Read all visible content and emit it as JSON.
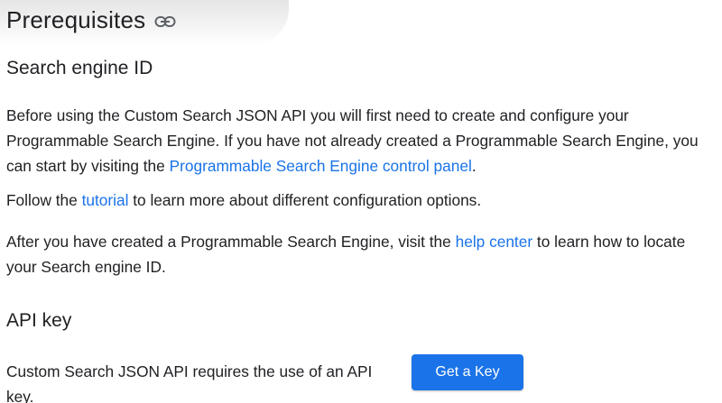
{
  "heading": "Prerequisites",
  "icons": {
    "heading_link": "link-icon"
  },
  "colors": {
    "link": "#1a73e8",
    "button_bg": "#1a73e8",
    "text": "#202124"
  },
  "search_engine": {
    "title": "Search engine ID",
    "para1_a": "Before using the Custom Search JSON API you will first need to create and configure your Programmable Search Engine. If you have not already created a Programmable Search Engine, you can start by visiting the ",
    "para1_link": "Programmable Search Engine control panel",
    "para1_b": ".",
    "para2_a": "Follow the ",
    "para2_link": "tutorial",
    "para2_b": " to learn more about different configuration options.",
    "para3_a": "After you have created a Programmable Search Engine, visit the ",
    "para3_link": "help center",
    "para3_b": " to learn how to locate your Search engine ID."
  },
  "api_key": {
    "title": "API key",
    "text": "Custom Search JSON API requires the use of an API key.",
    "button_label": "Get a Key"
  }
}
